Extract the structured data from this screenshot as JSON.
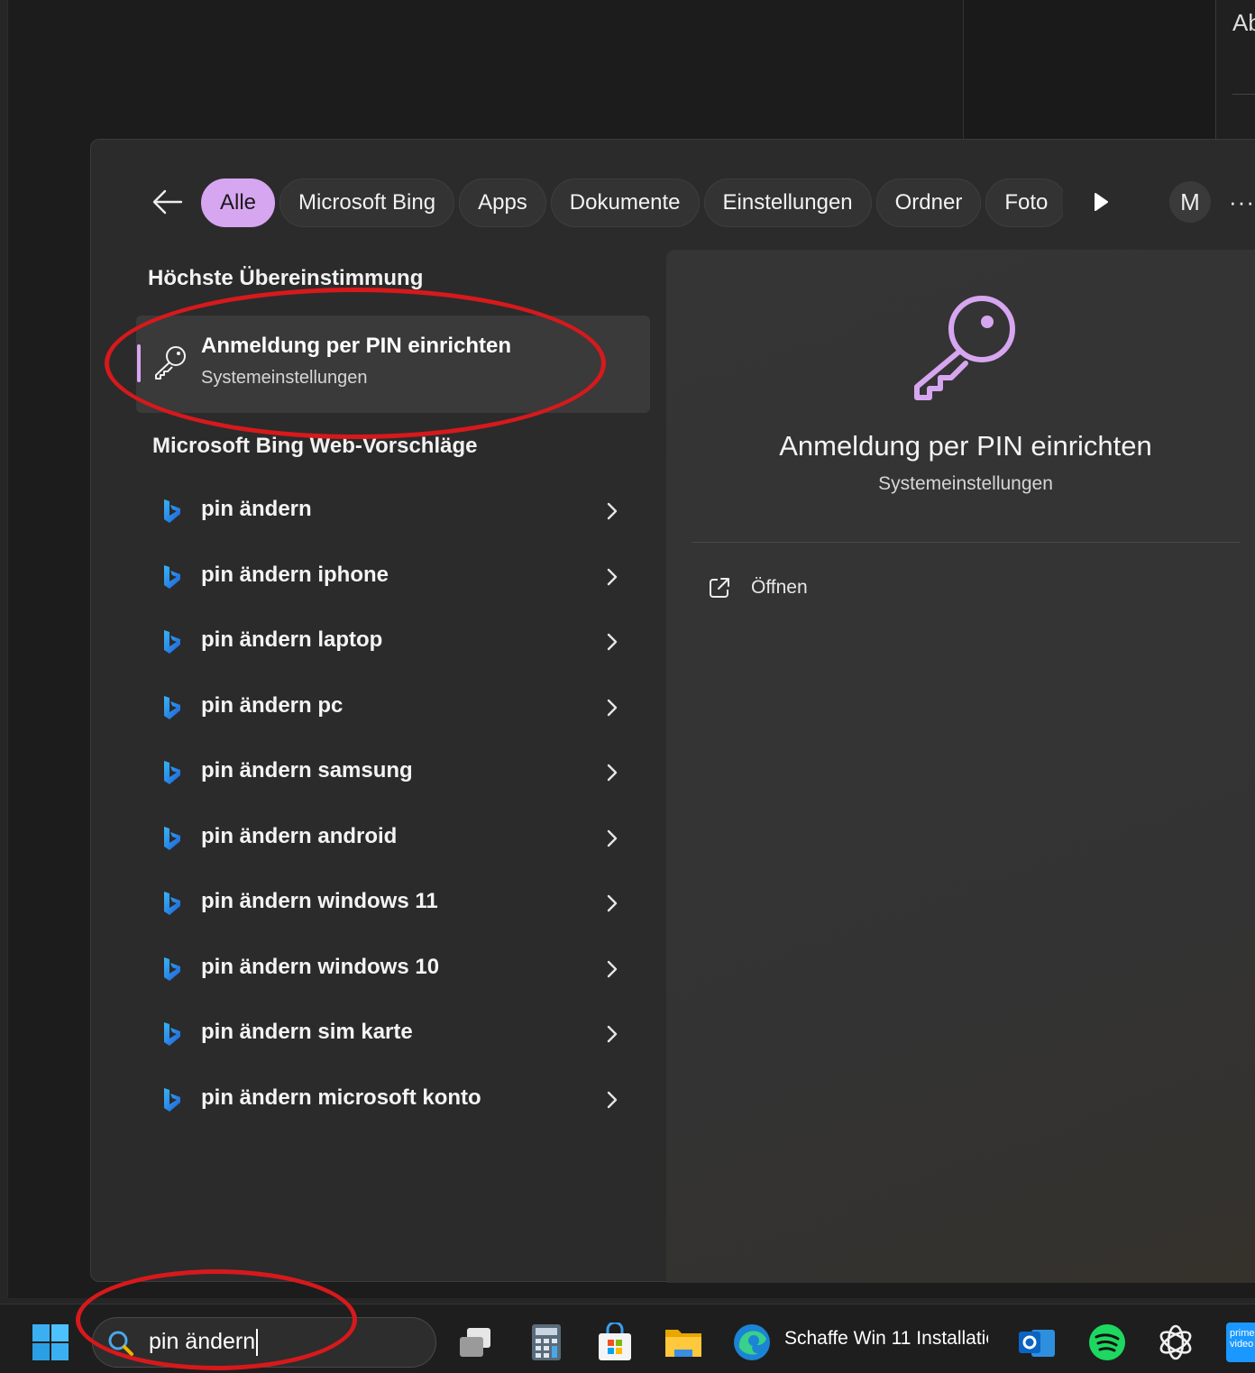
{
  "background": {
    "partial_text": "Ab"
  },
  "filter_bar": {
    "chips": [
      {
        "label": "Alle",
        "active": true
      },
      {
        "label": "Microsoft Bing",
        "active": false
      },
      {
        "label": "Apps",
        "active": false
      },
      {
        "label": "Dokumente",
        "active": false
      },
      {
        "label": "Einstellungen",
        "active": false
      },
      {
        "label": "Ordner",
        "active": false
      },
      {
        "label": "Foto",
        "active": false
      }
    ],
    "avatar_initial": "M",
    "more_label": "···"
  },
  "best_match": {
    "section_title": "Höchste Übereinstimmung",
    "title": "Anmeldung per PIN einrichten",
    "subtitle": "Systemeinstellungen",
    "icon": "key-icon"
  },
  "web_suggestions": {
    "section_title": "Microsoft Bing Web-Vorschläge",
    "items": [
      "pin ändern",
      "pin ändern iphone",
      "pin ändern laptop",
      "pin ändern pc",
      "pin ändern samsung",
      "pin ändern android",
      "pin ändern windows 11",
      "pin ändern windows 10",
      "pin ändern sim karte",
      "pin ändern microsoft konto"
    ]
  },
  "preview": {
    "title": "Anmeldung per PIN einrichten",
    "subtitle": "Systemeinstellungen",
    "open_label": "Öffnen"
  },
  "taskbar": {
    "search_query": "pin ändern",
    "edge_window_label": "Schaffe Win 11 Installatio",
    "prime_label": "prime video"
  },
  "colors": {
    "accent": "#d7a6f0",
    "panel": "#2b2b2b",
    "annotation": "#d7191c"
  }
}
